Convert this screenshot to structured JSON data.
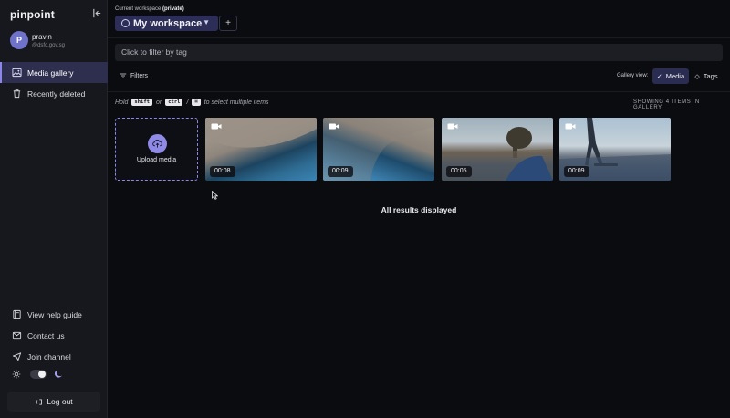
{
  "brand": {
    "logo_text": "pinpoint"
  },
  "user": {
    "initial": "P",
    "name": "pravin",
    "email": "@dsfc.gov.sg"
  },
  "sidebar": {
    "nav": [
      {
        "label": "Media gallery",
        "icon": "image-gallery-icon",
        "active": true
      },
      {
        "label": "Recently deleted",
        "icon": "trash-icon",
        "active": false
      }
    ],
    "bottom": [
      {
        "label": "View help guide",
        "icon": "book-icon"
      },
      {
        "label": "Contact us",
        "icon": "mail-icon"
      },
      {
        "label": "Join channel",
        "icon": "send-icon"
      }
    ],
    "logout_label": "Log out"
  },
  "header": {
    "workspace_label": "Current workspace",
    "workspace_privacy": "(private)",
    "workspace_name": "My workspace",
    "add_label": "+"
  },
  "filter": {
    "placeholder": "Click to filter by tag"
  },
  "toolbar": {
    "filters_label": "Filters",
    "gallery_view_label": "Gallery view:",
    "view_media": "Media",
    "view_tags": "Tags",
    "active_view": "Media"
  },
  "hint": {
    "prefix": "Hold",
    "key1": "shift",
    "or": "or",
    "key2": "ctrl",
    "slash": "/",
    "key3": "⌘",
    "suffix": "to select multiple items"
  },
  "showing_text": "SHOWING 4 ITEMS IN GALLERY",
  "upload_label": "Upload media",
  "media": [
    {
      "duration": "00:08"
    },
    {
      "duration": "00:09"
    },
    {
      "duration": "00:05"
    },
    {
      "duration": "00:09"
    }
  ],
  "footer_text": "All results displayed",
  "colors": {
    "accent": "#8b86e8",
    "workspace_bg": "#2d2e58",
    "sidebar_bg": "#17181d",
    "page_bg": "#0b0c10"
  }
}
